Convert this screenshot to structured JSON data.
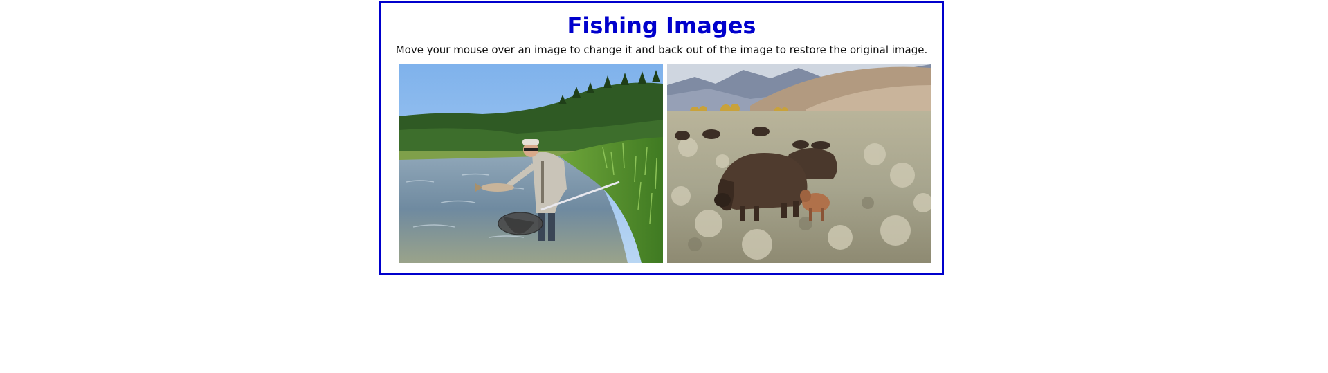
{
  "page": {
    "title": "Fishing Images",
    "instructions": "Move your mouse over an image to change it and back out of the image to restore the original image."
  },
  "images": [
    {
      "icon": "fly-fishing-photo",
      "subject": "angler holding trout in river with net"
    },
    {
      "icon": "bison-herd-photo",
      "subject": "bison grazing in sagebrush meadow"
    }
  ],
  "colors": {
    "border": "#0000cc",
    "title": "#0000cc",
    "text": "#111111",
    "background": "#ffffff"
  }
}
